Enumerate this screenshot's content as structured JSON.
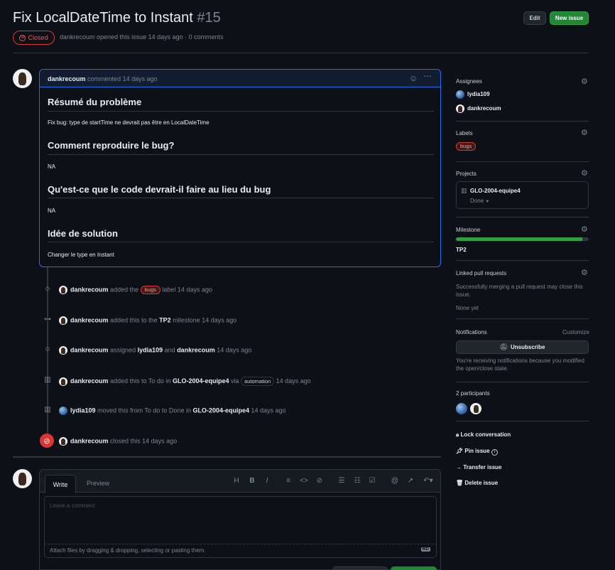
{
  "header": {
    "title": "Fix LocalDateTime to Instant",
    "number": "#15",
    "edit_label": "Edit",
    "new_issue_label": "New issue",
    "state": "Closed",
    "meta": "dankrecoum opened this issue 14 days ago · 0 comments"
  },
  "comment": {
    "author": "dankrecoum",
    "action": "commented",
    "time": "14 days ago",
    "sections": [
      {
        "heading": "Résumé du problème",
        "text": "Fix bug: type de startTime ne devrait pas être en LocalDateTime"
      },
      {
        "heading": "Comment reproduire le bug?",
        "text": "NA"
      },
      {
        "heading": "Qu'est-ce que le code devrait-il faire au lieu du bug",
        "text": "NA"
      },
      {
        "heading": "Idée de solution",
        "text": "Changer le type en Instant"
      }
    ]
  },
  "events": [
    {
      "user": "dankrecoum",
      "p1": "added the",
      "label": "bugs",
      "p2": "label",
      "time": "14 days ago"
    },
    {
      "user": "dankrecoum",
      "p1": "added this to the",
      "b1": "TP2",
      "p2": "milestone",
      "time": "14 days ago"
    },
    {
      "user": "dankrecoum",
      "p1": "assigned",
      "b1": "lydia109",
      "p2": "and",
      "b2": "dankrecoum",
      "time": "14 days ago"
    },
    {
      "user": "dankrecoum",
      "p1": "added this to To do in",
      "b1": "GLO-2004-equipe4",
      "p2": "via",
      "label": "automation",
      "time": "14 days ago"
    },
    {
      "user": "lydia109",
      "p1": "moved this from To do to Done in",
      "b1": "GLO-2004-equipe4",
      "time": "14 days ago"
    },
    {
      "user": "dankrecoum",
      "p1": "closed this",
      "time": "14 days ago"
    }
  ],
  "sidebar": {
    "assignees_title": "Assignees",
    "assignees": [
      "lydia109",
      "dankrecoum"
    ],
    "labels_title": "Labels",
    "label": "bugs",
    "projects_title": "Projects",
    "project_name": "GLO-2004-equipe4",
    "project_status": "Done",
    "milestone_title": "Milestone",
    "milestone_name": "TP2",
    "milestone_progress": 0.95,
    "linked_title": "Linked pull requests",
    "linked_desc": "Successfully merging a pull request may close this issue.",
    "linked_none": "None yet",
    "notifications_title": "Notifications",
    "customize": "Customize",
    "unsubscribe": "Unsubscribe",
    "notif_desc": "You're receiving notifications because you modified the open/close state.",
    "participants_title": "2 participants",
    "lock": "Lock conversation",
    "pin": "Pin issue",
    "transfer": "Transfer issue",
    "delete": "Delete issue"
  },
  "editor": {
    "tab_write": "Write",
    "tab_preview": "Preview",
    "placeholder": "Leave a comment",
    "attach": "Attach files by dragging & dropping, selecting or pasting them.",
    "md": "MD"
  }
}
